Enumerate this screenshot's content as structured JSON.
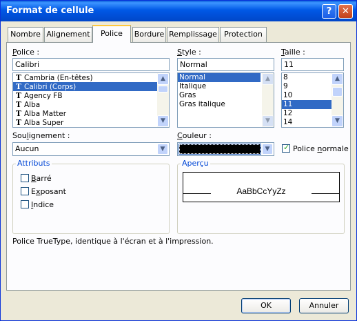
{
  "window": {
    "title": "Format de cellule"
  },
  "tabs": [
    "Nombre",
    "Alignement",
    "Police",
    "Bordure",
    "Remplissage",
    "Protection"
  ],
  "font": {
    "label_pre": "",
    "label_u": "P",
    "label_post": "olice :",
    "value": "Calibri",
    "items": [
      "Cambria (En-têtes)",
      "Calibri (Corps)",
      "Agency FB",
      "Alba",
      "Alba Matter",
      "Alba Super"
    ],
    "icon_glyph": "T"
  },
  "style": {
    "label_pre": "",
    "label_u": "S",
    "label_post": "tyle :",
    "value": "Normal",
    "items": [
      "Normal",
      "Italique",
      "Gras",
      "Gras italique"
    ]
  },
  "size": {
    "label_pre": "",
    "label_u": "T",
    "label_post": "aille :",
    "value": "11",
    "items": [
      "8",
      "9",
      "10",
      "11",
      "12",
      "14"
    ]
  },
  "underline": {
    "label_pre": "Sou",
    "label_u": "l",
    "label_post": "ignement :",
    "value": "Aucun"
  },
  "color": {
    "label_pre": "",
    "label_u": "C",
    "label_post": "ouleur :",
    "swatch": "#000000"
  },
  "normal_font": {
    "label_pre": "Police ",
    "label_u": "n",
    "label_post": "ormale",
    "checked": true
  },
  "effects": {
    "legend": "Attributs",
    "items": [
      {
        "pre": "",
        "u": "B",
        "post": "arré"
      },
      {
        "pre": "E",
        "u": "x",
        "post": "posant"
      },
      {
        "pre": "",
        "u": "I",
        "post": "ndice"
      }
    ]
  },
  "preview": {
    "legend": "Aperçu",
    "text": "AaBbCcYyZz"
  },
  "description": "Police TrueType, identique à l'écran et à l'impression.",
  "buttons": {
    "ok": "OK",
    "cancel": "Annuler"
  },
  "scroll": {
    "up": "▲",
    "down": "▼",
    "combo": "▼"
  },
  "title_buttons": {
    "help": "?",
    "close": "✕"
  },
  "colors": {
    "title_bar": "#0058e6",
    "selection": "#316ac5",
    "accent_tab": "#ffc83c"
  }
}
